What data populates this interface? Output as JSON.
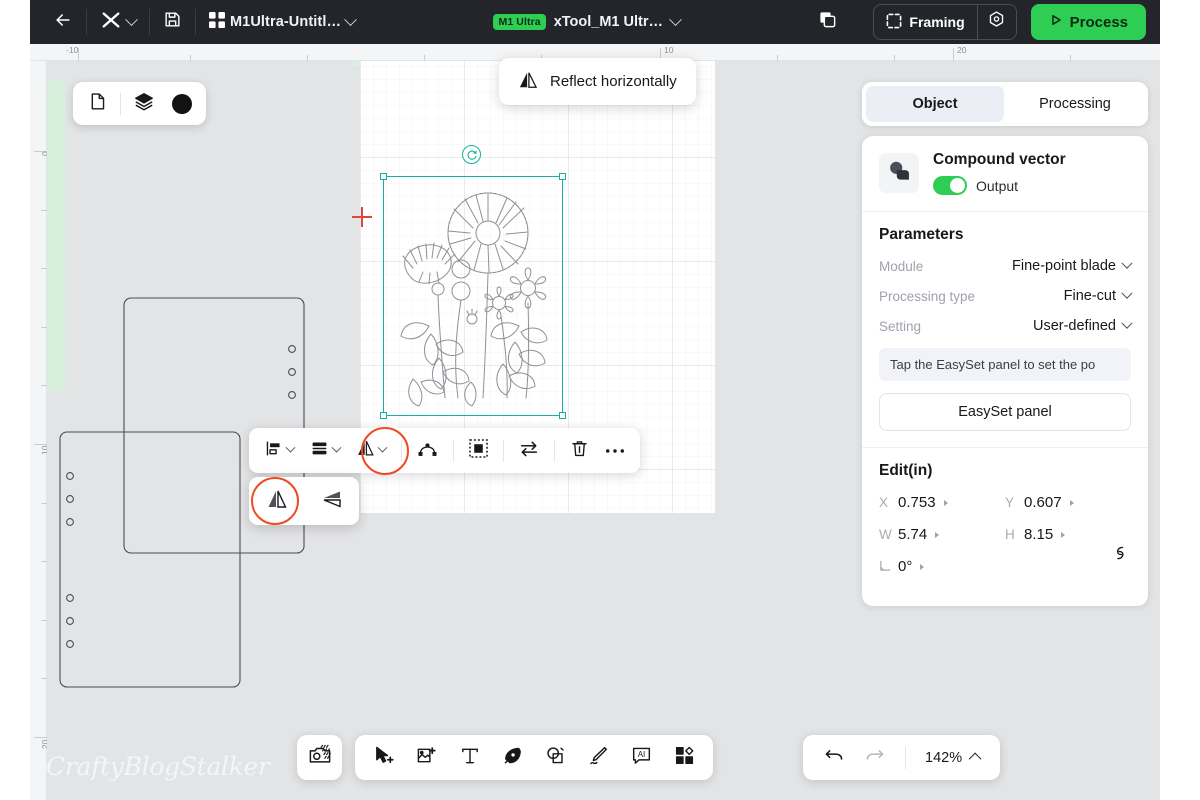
{
  "app": {
    "project_name": "M1Ultra-Untitl…",
    "machine_badge": "M1 Ultra",
    "machine_name": "xTool_M1 Ultr…",
    "back_icon": "arrow-left-icon",
    "logo_icon": "xtool-logo-icon",
    "save_icon": "floppy-save-icon",
    "project_icon": "grid-project-icon",
    "copies_icon": "duplicate-layers-icon",
    "framing_label": "Framing",
    "framing_icon": "framing-brackets-icon",
    "settings_icon": "gear-hex-icon",
    "process_label": "Process",
    "process_icon": "play-triangle-icon",
    "accent_green": "#2ece55",
    "topbar_bg": "#23252b"
  },
  "canvas_controls": {
    "page_icon": "page-document-icon",
    "layers_icon": "layers-stack-icon",
    "color_icon": "color-swatch-dot",
    "color_value": "#121212"
  },
  "tooltip": {
    "label": "Reflect horizontally",
    "icon": "reflect-horizontal-icon"
  },
  "context_toolbar": {
    "items": [
      {
        "name": "align-menu",
        "icon": "align-left-icon",
        "has_chevron": true
      },
      {
        "name": "distribute-menu",
        "icon": "distribute-rows-icon",
        "has_chevron": true
      },
      {
        "name": "reflect-menu",
        "icon": "reflect-horizontal-icon",
        "has_chevron": true,
        "highlighted": true
      },
      {
        "name": "node-edit",
        "icon": "node-edit-icon",
        "has_chevron": false
      },
      {
        "name": "trace-bitmap",
        "icon": "marquee-select-icon",
        "has_chevron": false
      },
      {
        "name": "swap-order",
        "icon": "swap-arrows-icon",
        "has_chevron": false
      },
      {
        "name": "delete",
        "icon": "trash-icon",
        "has_chevron": false
      },
      {
        "name": "more-options",
        "icon": "ellipsis-icon",
        "has_chevron": false
      }
    ]
  },
  "reflect_flyout": {
    "items": [
      {
        "name": "reflect-horizontally",
        "icon": "reflect-horizontal-icon",
        "selected": true
      },
      {
        "name": "reflect-vertically",
        "icon": "reflect-vertical-icon",
        "selected": false
      }
    ]
  },
  "bottom_toolbar": {
    "camera_icon": "camera-capture-icon",
    "tools": [
      {
        "name": "select-tool",
        "icon": "cursor-plus-icon"
      },
      {
        "name": "image-tool",
        "icon": "image-add-icon"
      },
      {
        "name": "text-tool",
        "icon": "text-t-icon"
      },
      {
        "name": "pen-tool",
        "icon": "pen-nib-icon"
      },
      {
        "name": "shape-tool",
        "icon": "shapes-icon"
      },
      {
        "name": "draw-tool",
        "icon": "pencil-draw-icon"
      },
      {
        "name": "ai-tool",
        "icon": "ai-badge-icon"
      },
      {
        "name": "apps-tool",
        "icon": "apps-grid-icon"
      }
    ],
    "undo_icon": "undo-arrow-icon",
    "redo_icon": "redo-arrow-icon",
    "zoom_level": "142%",
    "zoom_caret_icon": "caret-up-icon"
  },
  "rulers": {
    "unit": "mm",
    "horizontal_labels": [
      "-10",
      "10",
      "20"
    ],
    "vertical_labels": [
      "0",
      "10",
      "20"
    ]
  },
  "panel": {
    "tabs": [
      {
        "label": "Object",
        "active": true
      },
      {
        "label": "Processing",
        "active": false
      }
    ],
    "object": {
      "icon": "compound-vector-icon",
      "title": "Compound vector",
      "output_label": "Output",
      "output_on": true
    },
    "parameters": {
      "title": "Parameters",
      "rows": [
        {
          "label": "Module",
          "value": "Fine-point blade"
        },
        {
          "label": "Processing type",
          "value": "Fine-cut"
        },
        {
          "label": "Setting",
          "value": "User-defined"
        }
      ],
      "hint": "Tap the EasySet panel to set the po",
      "easyset_button": "EasySet panel"
    },
    "edit": {
      "title": "Edit(in)",
      "fields": [
        {
          "key": "X",
          "value": "0.753"
        },
        {
          "key": "Y",
          "value": "0.607"
        },
        {
          "key": "W",
          "value": "5.74"
        },
        {
          "key": "H",
          "value": "8.15"
        }
      ],
      "rotation_key": "angle-icon",
      "rotation_value": "0°",
      "link_icon": "link-chain-icon"
    }
  },
  "watermark": {
    "text": "CraftyBlogStalker"
  }
}
